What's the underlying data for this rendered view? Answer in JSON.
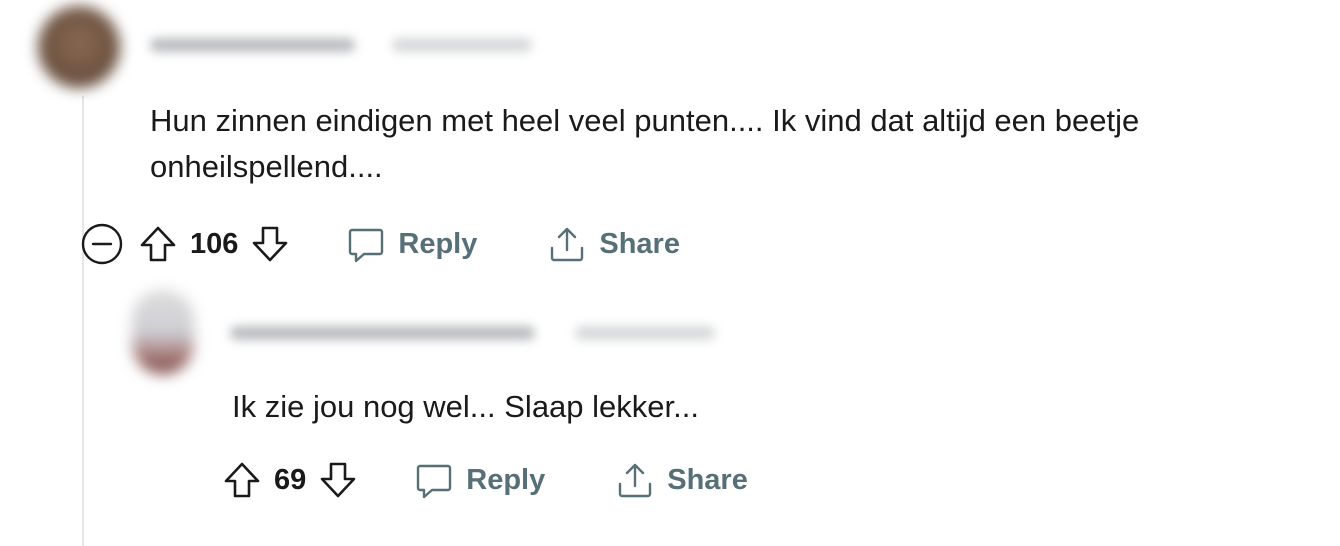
{
  "comments": [
    {
      "body": "Hun zinnen eindigen met heel veel punten.... Ik vind dat altijd een beetje onheilspellend....",
      "votes": "106",
      "reply_label": "Reply",
      "share_label": "Share"
    },
    {
      "body": "Ik zie jou nog wel... Slaap lekker...",
      "votes": "69",
      "reply_label": "Reply",
      "share_label": "Share"
    }
  ],
  "icons": {
    "collapse": "collapse-thread-icon",
    "upvote": "upvote-arrow-icon",
    "downvote": "downvote-arrow-icon",
    "reply": "speech-bubble-icon",
    "share": "share-upload-icon"
  },
  "colors": {
    "text": "#1a1a1b",
    "action": "#576f76",
    "thread_line": "#e5e7e8"
  }
}
